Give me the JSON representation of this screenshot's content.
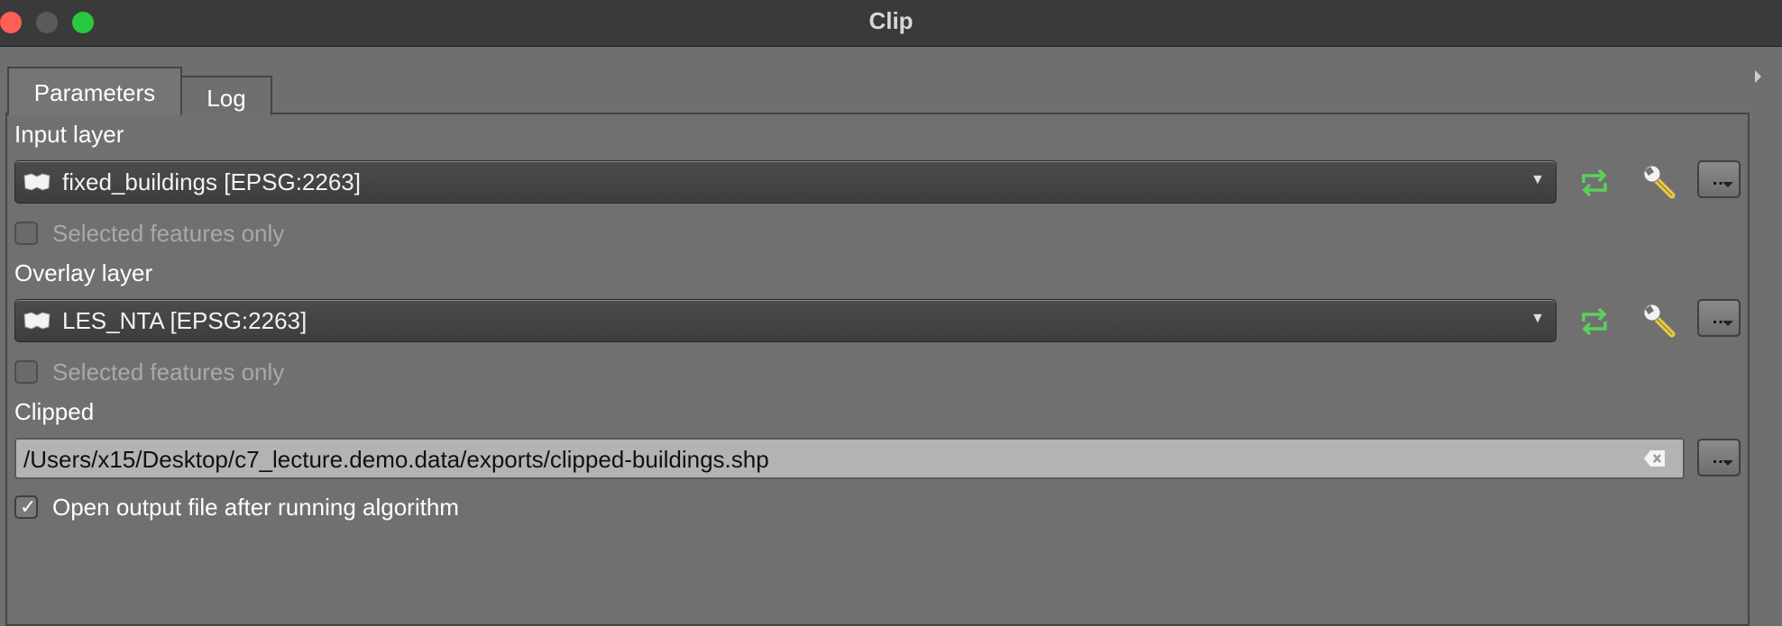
{
  "window": {
    "title": "Clip"
  },
  "tabs": [
    {
      "label": "Parameters",
      "active": true
    },
    {
      "label": "Log",
      "active": false
    }
  ],
  "input_layer": {
    "label": "Input layer",
    "value": "fixed_buildings [EPSG:2263]",
    "selected_only_label": "Selected features only",
    "selected_only_checked": false
  },
  "overlay_layer": {
    "label": "Overlay layer",
    "value": "LES_NTA [EPSG:2263]",
    "selected_only_label": "Selected features only",
    "selected_only_checked": false
  },
  "output": {
    "label": "Clipped",
    "path": "/Users/x15/Desktop/c7_lecture.demo.data/exports/clipped-buildings.shp",
    "open_after_label": "Open output file after running algorithm",
    "open_after_checked": true
  },
  "icons": {
    "iterate": "cycle-icon",
    "advanced": "wrench-icon",
    "browse": "ellipsis-dropdown-icon",
    "clear": "clear-icon",
    "layer": "polygon-layer-icon"
  },
  "colors": {
    "titlebar": "#3a3a3a",
    "dialog_bg": "#6f6f6f",
    "iterate_green": "#5bd05b",
    "wrench_yellow": "#e8c84a",
    "close": "#ff5f57",
    "maximize": "#28c840"
  }
}
